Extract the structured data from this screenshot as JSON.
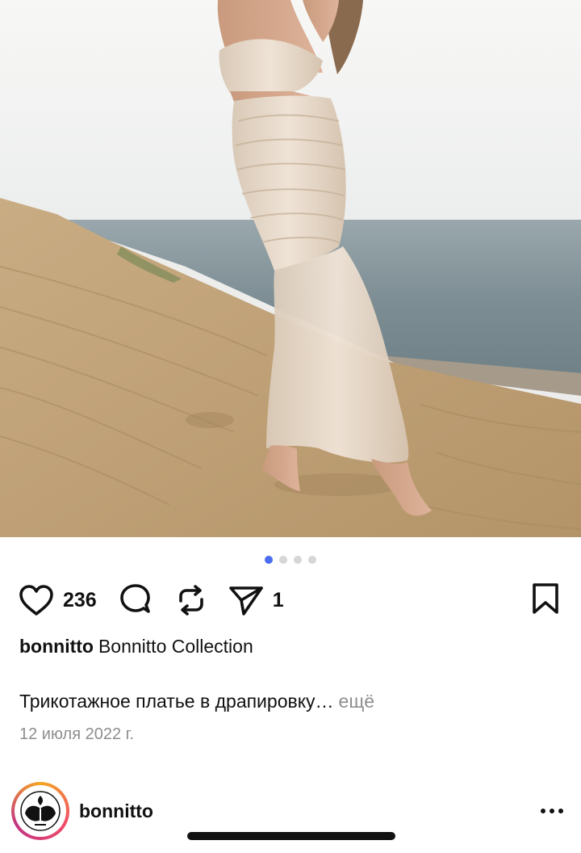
{
  "post": {
    "carousel": {
      "count": 4,
      "active_index": 0
    },
    "likes_count": "236",
    "shares_count": "1",
    "owner_handle": "bonnitto",
    "owner_full_name": "Bonnitto Collection",
    "caption_text": "Трикотажное платье в драпировку…",
    "caption_more": "ещё",
    "date": "12 июля 2022 г."
  },
  "next_post": {
    "username": "bonnitto"
  },
  "icons": {
    "like": "heart-icon",
    "comment": "comment-icon",
    "repost": "repost-icon",
    "share": "send-icon",
    "save": "bookmark-icon",
    "more": "more-horizontal-icon"
  },
  "colors": {
    "active_dot": "#4a6cf0",
    "inactive_dot": "#d6d6d6",
    "muted_text": "#8e8e8e"
  }
}
